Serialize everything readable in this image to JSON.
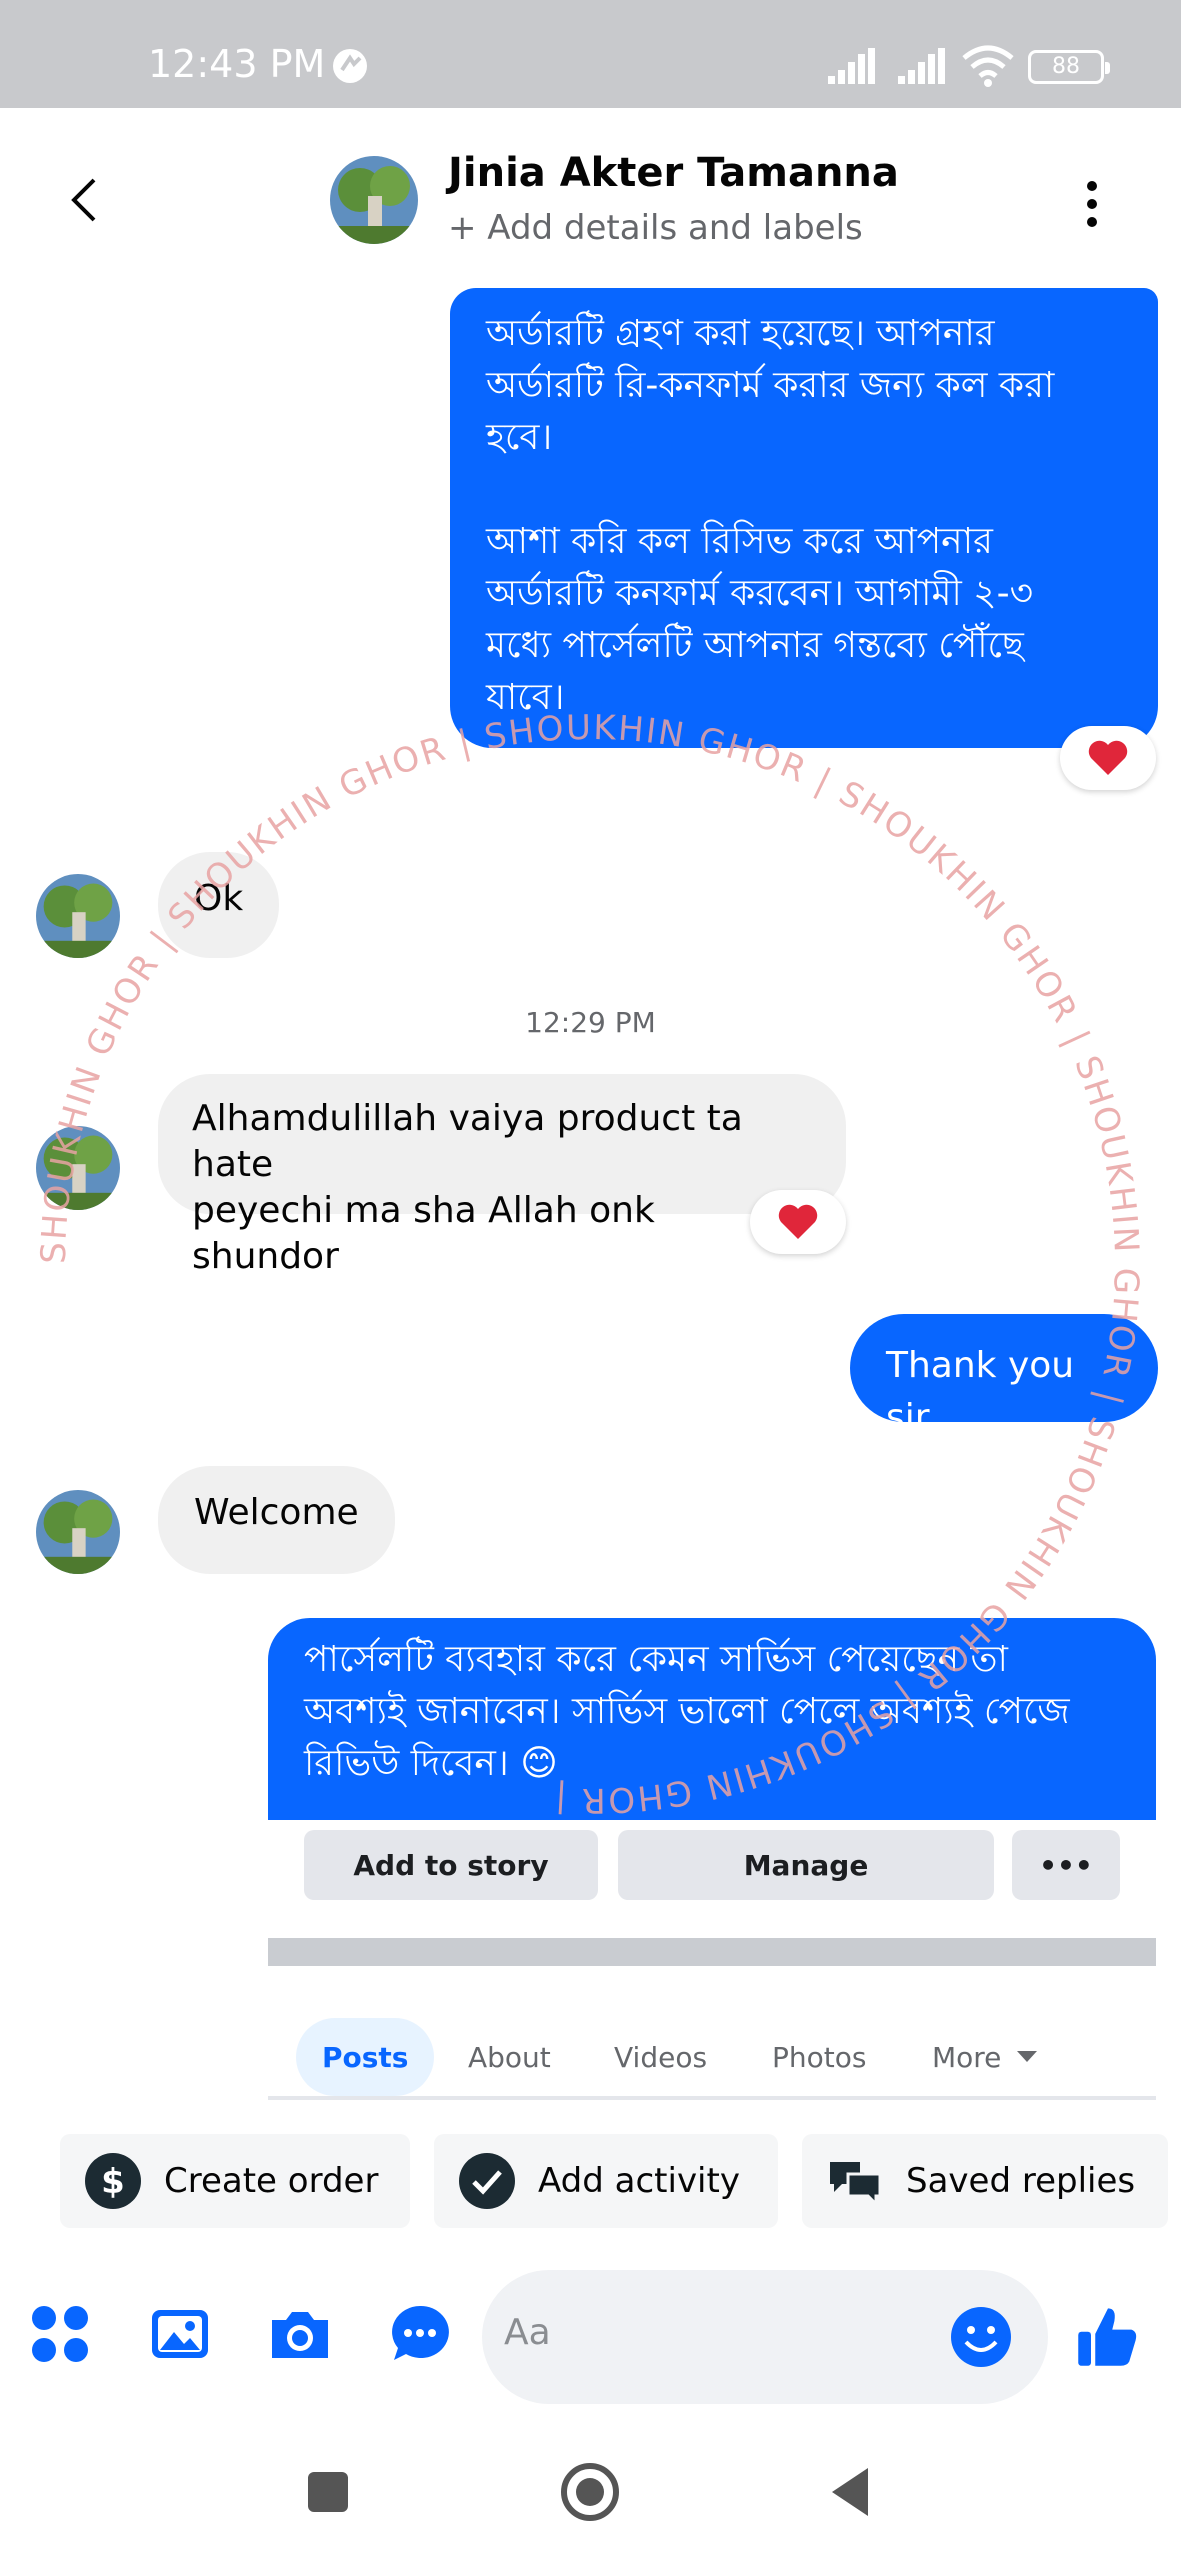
{
  "status_bar": {
    "time": "12:43 PM",
    "battery": "88"
  },
  "header": {
    "name": "Jinia Akter Tamanna",
    "subtitle": "+ Add details and labels"
  },
  "messages": {
    "m1": "অর্ডারটি গ্রহণ করা হয়েছে। আপনার\nঅর্ডারটি রি-কনফার্ম করার জন্য কল করা\nহবে।\n\nআশা করি কল রিসিভ করে আপনার\nঅর্ডারটি কনফার্ম করবেন। আগামী ২-৩\nমধ্যে পার্সেলটি আপনার গন্তব্যে পৌঁছে\nযাবে।",
    "m2": "Ok",
    "timestamp": "12:29 PM",
    "m3": "Alhamdulillah vaiya product ta hate\npeyechi ma sha Allah onk shundor",
    "m4": "Thank you sir",
    "m5": "Welcome",
    "m6": "পার্সেলটি ব্যবহার করে কেমন সার্ভিস পেয়েছেন তা\nঅবশ্যই জানাবেন। সার্ভিস ভালো পেলে অবশ্যই পেজে\nরিভিউ দিবেন। 😊",
    "reaction": "❤️"
  },
  "page_preview": {
    "add_to_story": "Add to story",
    "manage": "Manage",
    "more_dots": "•••",
    "tabs": [
      "Posts",
      "About",
      "Videos",
      "Photos",
      "More"
    ]
  },
  "watermark": {
    "text": "SHOUKHIN GHOR | SHOUKHIN GHOR | SHOUKHIN GHOR | SHOUKHIN GHOR | SHOUKHIN GHOR | SHOUKHIN GHOR | SHOUKHIN GHOR | "
  },
  "actions": {
    "create_order": "Create order",
    "add_activity": "Add activity",
    "saved_replies": "Saved replies"
  },
  "composer": {
    "placeholder": "Aa"
  },
  "colors": {
    "accent": "#0866ff",
    "incoming_bubble": "#f0f0f0",
    "reaction_heart": "#e0263a",
    "watermark": "#e8a3a3"
  }
}
